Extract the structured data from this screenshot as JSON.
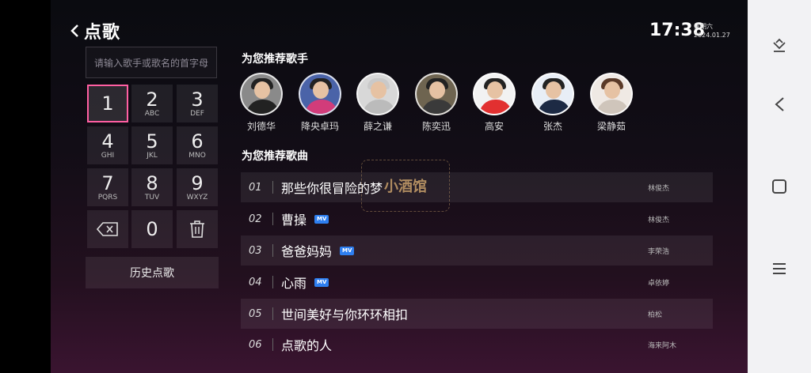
{
  "header": {
    "title": "点歌",
    "time": "17:38",
    "weekday": "星期六",
    "date": "2024.01.27"
  },
  "search": {
    "placeholder": "请输入歌手或歌名的首字母"
  },
  "keypad": {
    "keys": [
      {
        "num": "1",
        "letters": ""
      },
      {
        "num": "2",
        "letters": "ABC"
      },
      {
        "num": "3",
        "letters": "DEF"
      },
      {
        "num": "4",
        "letters": "GHI"
      },
      {
        "num": "5",
        "letters": "JKL"
      },
      {
        "num": "6",
        "letters": "MNO"
      },
      {
        "num": "7",
        "letters": "PQRS"
      },
      {
        "num": "8",
        "letters": "TUV"
      },
      {
        "num": "9",
        "letters": "WXYZ"
      },
      {
        "num": "0",
        "letters": ""
      }
    ],
    "history_label": "历史点歌"
  },
  "singers_section": {
    "title": "为您推荐歌手",
    "singers": [
      {
        "name": "刘德华"
      },
      {
        "name": "降央卓玛"
      },
      {
        "name": "薛之谦"
      },
      {
        "name": "陈奕迅"
      },
      {
        "name": "高安"
      },
      {
        "name": "张杰"
      },
      {
        "name": "梁静茹"
      }
    ]
  },
  "songs_section": {
    "title": "为您推荐歌曲",
    "songs": [
      {
        "index": "01",
        "name": "那些你很冒险的梦",
        "mv": "",
        "artist": "林俊杰"
      },
      {
        "index": "02",
        "name": "曹操",
        "mv": "MV",
        "artist": "林俊杰"
      },
      {
        "index": "03",
        "name": "爸爸妈妈",
        "mv": "MV",
        "artist": "李荣浩"
      },
      {
        "index": "04",
        "name": "心雨",
        "mv": "MV",
        "artist": "卓依婷"
      },
      {
        "index": "05",
        "name": "世间美好与你环环相扣",
        "mv": "",
        "artist": "柏松"
      },
      {
        "index": "06",
        "name": "点歌的人",
        "mv": "",
        "artist": "海来阿木"
      }
    ]
  },
  "watermark": {
    "text": "小酒馆"
  },
  "colors": {
    "accent": "#ff5fa2",
    "mv_badge": "#2e7ff0"
  }
}
